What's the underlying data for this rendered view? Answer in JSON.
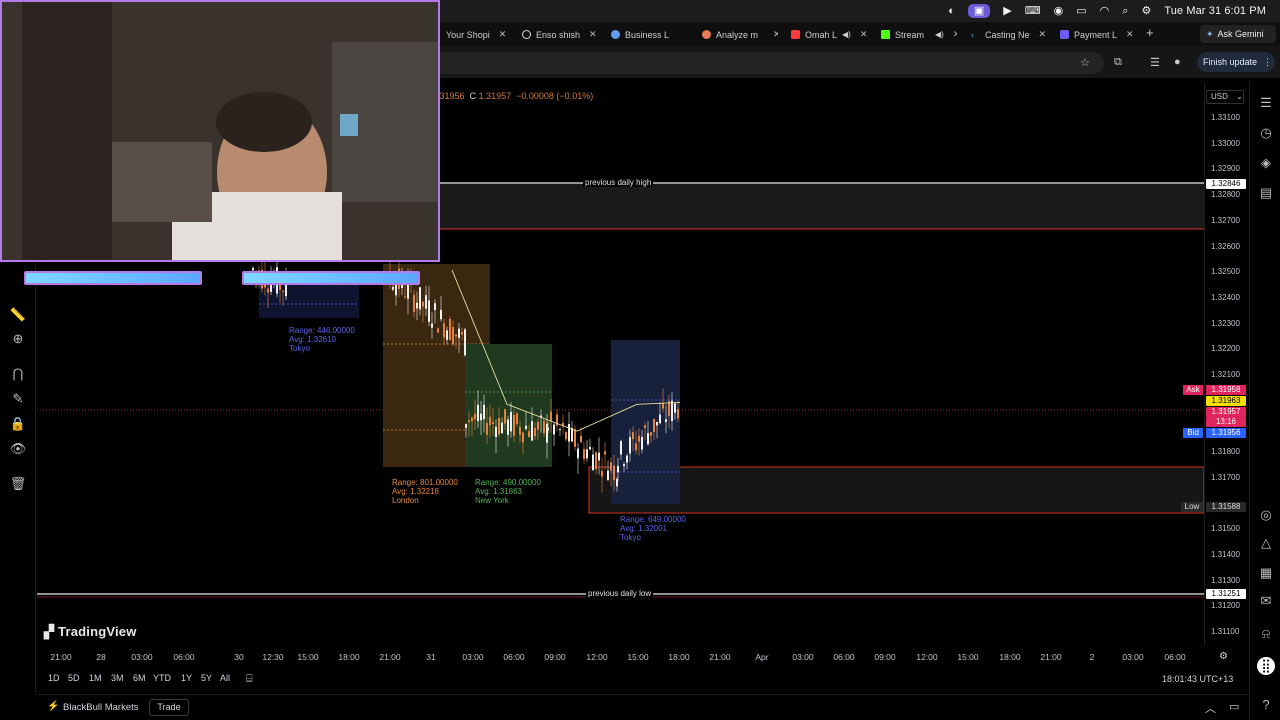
{
  "menubar": {
    "datetime": "Tue Mar 31  6:01 PM"
  },
  "browser": {
    "tabs": [
      {
        "label": "Your Shopi",
        "color": "#7cc36b"
      },
      {
        "label": "Enso shish",
        "color": "#e6e6e6"
      },
      {
        "label": "Business L",
        "color": "#5e9cf5"
      },
      {
        "label": "Analyze m",
        "color": "#e87a56"
      },
      {
        "label": "Omah L",
        "color": "#ff3b3b"
      },
      {
        "label": "Stream",
        "color": "#53fc18"
      },
      {
        "label": "Casting Ne",
        "color": "#3aa7ff"
      },
      {
        "label": "Payment L",
        "color": "#6f5bff"
      }
    ],
    "ask_gemini": "Ask Gemini",
    "finish_update": "Finish update"
  },
  "chart": {
    "currency": "USD",
    "ohlc_prefix": "1.31956",
    "ohlc_close_label": "C",
    "ohlc_close": "1.31957",
    "ohlc_change": "−0.00008 (−0.01%)",
    "previous_daily_high": "previous daily high",
    "previous_daily_low": "previous daily low",
    "price_labels": [
      "1.33100",
      "1.33000",
      "1.32900",
      "1.32800",
      "1.32700",
      "1.32600",
      "1.32500",
      "1.32400",
      "1.32300",
      "1.32200",
      "1.32100",
      "1.31800",
      "1.31700",
      "1.31500",
      "1.31400",
      "1.31300",
      "1.31200",
      "1.31100"
    ],
    "badges": {
      "prev_high": "1.32846",
      "ask_label": "Ask",
      "ask": "1.31958",
      "last": "1.31963",
      "current": "1.31957",
      "countdown": "13:16",
      "bid_label": "Bid",
      "bid": "1.31956",
      "low_label": "Low",
      "low": "1.31588",
      "prev_low": "1.31251"
    },
    "sessions": [
      {
        "range": "Range: 446.00000",
        "avg": "Avg: 1.32610",
        "name": "Tokyo",
        "color": "#5a64e8"
      },
      {
        "range": "Range: 801.00000",
        "avg": "Avg: 1.32218",
        "name": "London",
        "color": "#e7873a"
      },
      {
        "range": "Range: 490.00000",
        "avg": "Avg: 1.31863",
        "name": "New York",
        "color": "#58b25a"
      },
      {
        "range": "Range: 649.00000",
        "avg": "Avg: 1.32001",
        "name": "Tokyo",
        "color": "#5a64e8"
      }
    ],
    "time_labels": [
      "21:00",
      "28",
      "03:00",
      "06:00",
      "30",
      "12:30",
      "15:00",
      "18:00",
      "21:00",
      "31",
      "03:00",
      "06:00",
      "09:00",
      "12:00",
      "15:00",
      "18:00",
      "21:00",
      "Apr",
      "03:00",
      "06:00",
      "09:00",
      "12:00",
      "15:00",
      "18:00",
      "21:00",
      "2",
      "03:00",
      "06:00"
    ],
    "brand": "TradingView",
    "ranges": [
      "1D",
      "5D",
      "1M",
      "3M",
      "6M",
      "YTD",
      "1Y",
      "5Y",
      "All"
    ],
    "clock": "18:01:43 UTC+13"
  },
  "broker": {
    "name": "BlackBull Markets",
    "trade": "Trade"
  },
  "chart_data": {
    "type": "line",
    "title": "",
    "xlabel": "",
    "ylabel": "",
    "ylim": [
      1.3105,
      1.3315
    ],
    "x": [
      "31 06:00",
      "31 09:00",
      "31 12:00",
      "31 15:00",
      "31 18:00"
    ],
    "series": [
      {
        "values": [
          1.3245,
          1.3195,
          1.3185,
          1.3195,
          1.31957
        ]
      }
    ],
    "annotations": [
      "previous daily high 1.32846",
      "previous daily low 1.31251"
    ]
  }
}
